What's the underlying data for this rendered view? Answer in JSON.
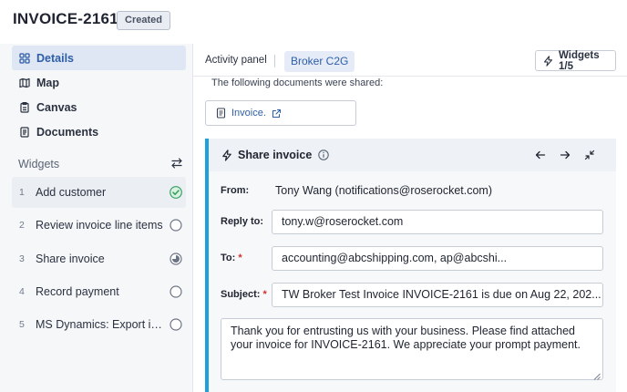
{
  "header": {
    "title": "INVOICE-2161",
    "status_badge": "Created"
  },
  "sidebar": {
    "nav": [
      {
        "label": "Details",
        "icon": "details-icon",
        "active": true
      },
      {
        "label": "Map",
        "icon": "map-icon"
      },
      {
        "label": "Canvas",
        "icon": "canvas-icon"
      },
      {
        "label": "Documents",
        "icon": "documents-icon"
      }
    ],
    "widgets_title": "Widgets",
    "widgets": [
      {
        "num": "1",
        "label": "Add customer",
        "status": "complete"
      },
      {
        "num": "2",
        "label": "Review invoice line items",
        "status": "empty"
      },
      {
        "num": "3",
        "label": "Share invoice",
        "status": "in-progress"
      },
      {
        "num": "4",
        "label": "Record payment",
        "status": "empty"
      },
      {
        "num": "5",
        "label": "MS Dynamics: Export invoice",
        "status": "empty"
      }
    ]
  },
  "main": {
    "tabs": {
      "activity": "Activity panel",
      "broker": "Broker C2G"
    },
    "widgets_button": "Widgets 1/5",
    "shared_text": "The following documents were shared:",
    "shared_doc": "Invoice.",
    "share_card": {
      "title": "Share invoice",
      "from_label": "From:",
      "from_value": "Tony Wang (notifications@roserocket.com)",
      "reply_label": "Reply to:",
      "reply_value": "tony.w@roserocket.com",
      "to_label": "To:",
      "to_value": "accounting@abcshipping.com, ap@abcshi...",
      "subject_label": "Subject:",
      "subject_value": "TW Broker Test Invoice INVOICE-2161 is due on Aug 22, 202...",
      "message": "Thank you for entrusting us with your business. Please find attached your invoice for INVOICE-2161. We appreciate your prompt payment.",
      "required_mark": "*"
    }
  },
  "colors": {
    "accent": "#2e5ea8",
    "card_accent": "#1ea0d8",
    "success": "#2e9e5b",
    "required": "#d32f2f"
  }
}
